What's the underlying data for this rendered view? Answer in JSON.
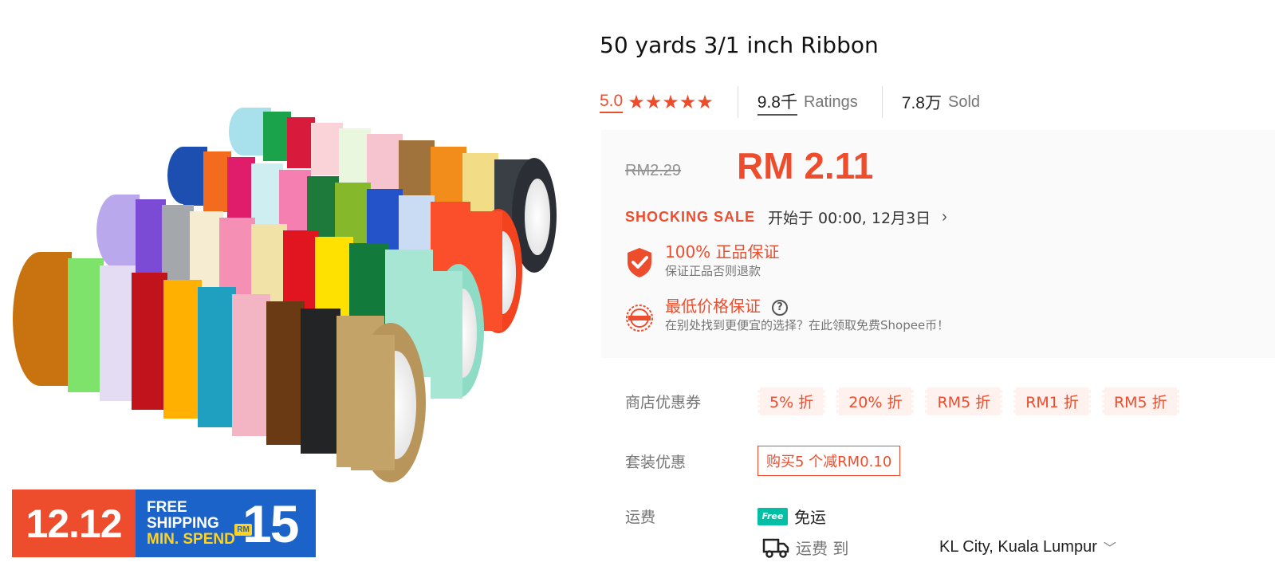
{
  "product": {
    "title": "50 yards 3/1 inch Ribbon",
    "rating": "5.0",
    "stars": "★★★★★",
    "ratings_count": "9.8千",
    "ratings_label": "Ratings",
    "sold_count": "7.8万",
    "sold_label": "Sold"
  },
  "price": {
    "original": "RM2.29",
    "current": "RM 2.11",
    "sale_label": "SHOCKING SALE",
    "sale_time": "开始于 00:00, 12月3日",
    "sale_arrow": "›"
  },
  "guarantees": {
    "authentic_title": "100% 正品保证",
    "authentic_sub": "保证正品否则退款",
    "lowest_title": "最低价格保证",
    "lowest_help": "?",
    "lowest_sub": "在别处找到更便宜的选择？在此领取免费Shopee币！"
  },
  "vouchers": {
    "label": "商店优惠券",
    "items": [
      "5% 折",
      "20% 折",
      "RM5 折",
      "RM1 折",
      "RM5 折"
    ]
  },
  "bundle": {
    "label": "套装优惠",
    "deal": "购买5 个减RM0.10"
  },
  "shipping": {
    "label": "运费",
    "free_badge": "Free",
    "free_text": "免运",
    "to_label": "运费 到",
    "location": "KL City, Kuala Lumpur",
    "chevron": "﹀"
  },
  "promo": {
    "date": "12.12",
    "line1": "FREE",
    "line2": "SHIPPING",
    "line3": "MIN. SPEND",
    "currency": "RM",
    "amount": "15"
  },
  "colors": {
    "accent": "#ee4d2d",
    "promo_blue": "#1c63c9",
    "free_teal": "#00bfa5"
  },
  "icons": {
    "shield": "shield-check-icon",
    "badge": "guarantee-seal-icon",
    "help": "question-circle-icon",
    "truck": "truck-icon"
  }
}
